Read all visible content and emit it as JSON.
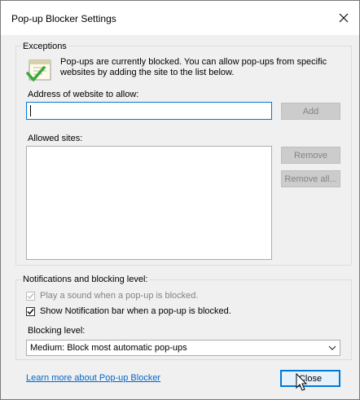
{
  "window": {
    "title": "Pop-up Blocker Settings"
  },
  "exceptions": {
    "group_label": "Exceptions",
    "info_text": "Pop-ups are currently blocked.  You can allow pop-ups from specific websites by adding the site to the list below.",
    "address_label": "Address of website to allow:",
    "address_value": "",
    "add_label": "Add",
    "allowed_label": "Allowed sites:",
    "allowed_sites": [],
    "remove_label": "Remove",
    "remove_all_label": "Remove all..."
  },
  "notifications": {
    "group_label": "Notifications and blocking level:",
    "play_sound_label": "Play a sound when a pop-up is blocked.",
    "play_sound_checked": true,
    "play_sound_enabled": false,
    "show_bar_label": "Show Notification bar when a pop-up is blocked.",
    "show_bar_checked": true,
    "blocking_level_label": "Blocking level:",
    "blocking_level_value": "Medium: Block most automatic pop-ups"
  },
  "footer": {
    "learn_more": "Learn more about Pop-up Blocker",
    "close_label": "Close"
  },
  "icons": {
    "close": "close-icon",
    "info": "document-checkmark-icon",
    "dropdown": "chevron-down-icon",
    "cursor": "mouse-pointer-icon"
  },
  "colors": {
    "accent": "#0078d7",
    "link": "#0066cc",
    "check": "#3aa83a"
  }
}
